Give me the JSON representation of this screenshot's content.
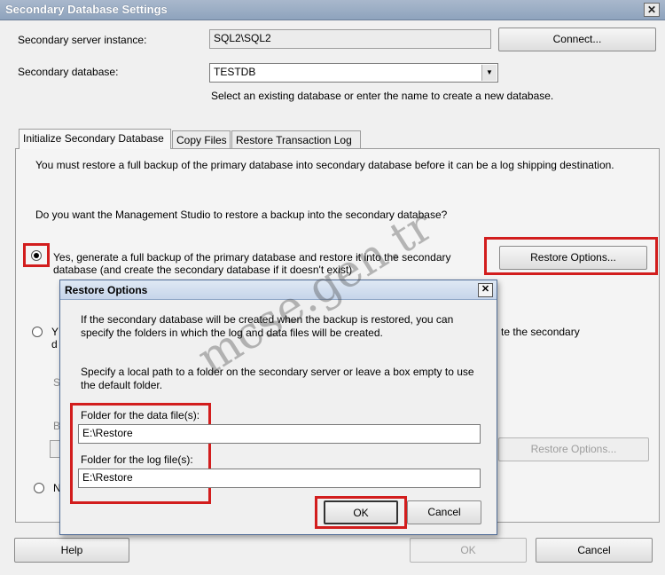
{
  "window": {
    "title": "Secondary Database Settings",
    "close_glyph": "✕"
  },
  "server": {
    "label": "Secondary server instance:",
    "value": "SQL2\\SQL2",
    "connect_button": "Connect..."
  },
  "database": {
    "label": "Secondary database:",
    "value": "TESTDB",
    "dropdown_glyph": "▼",
    "hint": "Select an existing database or enter the name to create a new database."
  },
  "tabs": [
    {
      "label": "Initialize Secondary Database",
      "active": true
    },
    {
      "label": "Copy Files",
      "active": false
    },
    {
      "label": "Restore Transaction Log",
      "active": false
    }
  ],
  "init_tab": {
    "intro": "You must restore a full backup of the primary database into secondary database before it can be a log shipping destination.",
    "question": "Do you want the Management Studio to restore a backup into the secondary database?",
    "option1_line1": "Yes, generate a full backup of the primary database and restore it into the secondary",
    "option1_line2": "database (and create the secondary database if it doesn't exist)",
    "option1_selected": true,
    "restore_options_button": "Restore Options...",
    "option2_partial": "Y",
    "option2_partial2": "d",
    "option2_tail": "te the secondary",
    "partial_s": "S",
    "partial_b": "B",
    "restore_options_button_disabled": "Restore Options...",
    "option3_partial": "N"
  },
  "restore_dialog": {
    "title": "Restore Options",
    "close_glyph": "✕",
    "desc1_line1": "If the secondary database will be created when the backup is restored, you can",
    "desc1_line2": "specify the folders in which the log and data files will be created.",
    "desc2_line1": "Specify a local path to a folder on the secondary server or leave a box empty to use",
    "desc2_line2": "the default folder.",
    "data_label": "Folder for the data file(s):",
    "data_value": "E:\\Restore",
    "log_label": "Folder for the log file(s):",
    "log_value": "E:\\Restore",
    "ok_button": "OK",
    "cancel_button": "Cancel"
  },
  "footer": {
    "help_button": "Help",
    "ok_button": "OK",
    "cancel_button": "Cancel"
  },
  "watermark": "mcse.gen.tr",
  "colors": {
    "highlight": "#d21d1d",
    "title_bar": "#8ea3bd"
  }
}
